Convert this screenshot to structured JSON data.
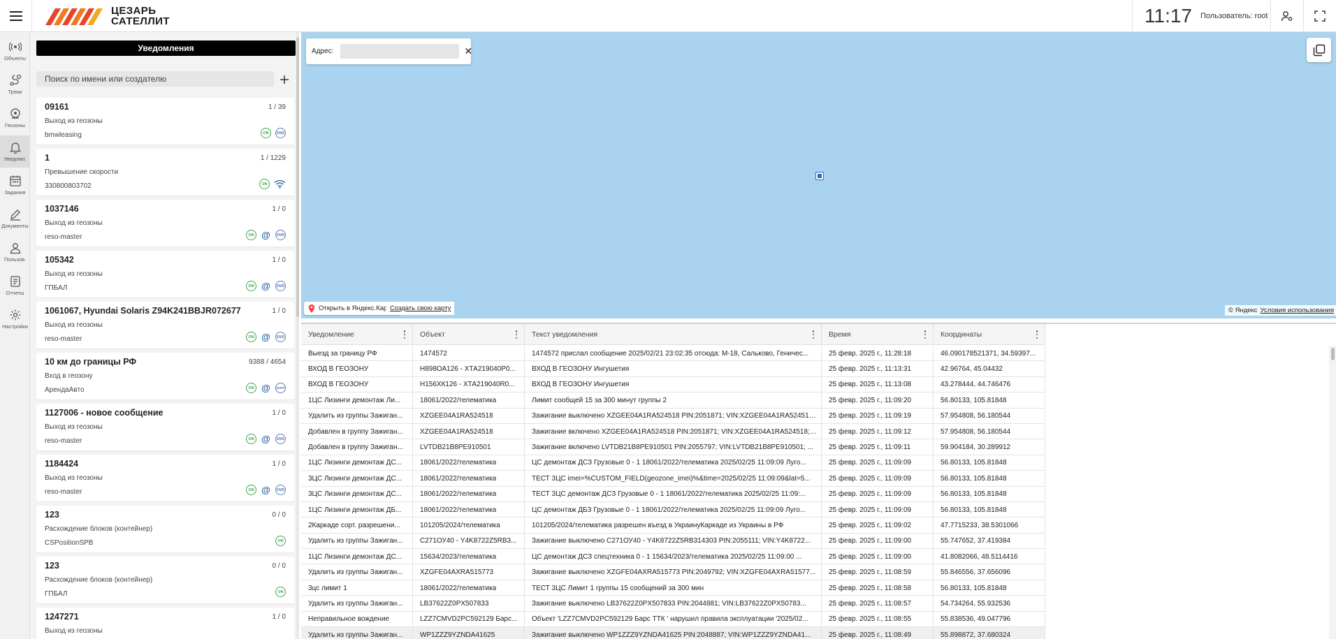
{
  "header": {
    "logo_line1": "ЦЕЗАРЬ",
    "logo_line2": "САТЕЛЛИТ",
    "time": "11:17",
    "user_label": "Пользователь: root"
  },
  "nav": [
    {
      "label": "Объекты",
      "icon": "antenna-icon"
    },
    {
      "label": "Треки",
      "icon": "route-icon"
    },
    {
      "label": "Геозоны",
      "icon": "geozone-icon"
    },
    {
      "label": "Уведомл.",
      "icon": "bell-icon"
    },
    {
      "label": "Задания",
      "icon": "calendar-icon"
    },
    {
      "label": "Документы",
      "icon": "pen-icon"
    },
    {
      "label": "Пользов.",
      "icon": "user-icon"
    },
    {
      "label": "Отчеты",
      "icon": "report-icon"
    },
    {
      "label": "Настройки",
      "icon": "gear-icon"
    }
  ],
  "panel": {
    "title": "Уведомления",
    "search_placeholder": "Поиск по имени или создателю",
    "cards": [
      {
        "title": "09161",
        "count": "1 / 39",
        "type": "Выход из геозоны",
        "creator": "bmwleasing",
        "icons": [
          "on",
          "sms"
        ]
      },
      {
        "title": "1",
        "count": "1 / 1229",
        "type": "Превышение скорости",
        "creator": "330800803702",
        "icons": [
          "on",
          "wifi"
        ]
      },
      {
        "title": "1037146",
        "count": "1 / 0",
        "type": "Выход из геозоны",
        "creator": "reso-master",
        "icons": [
          "on",
          "at",
          "sms"
        ]
      },
      {
        "title": "105342",
        "count": "1 / 0",
        "type": "Выход из геозоны",
        "creator": "ГПБАЛ",
        "icons": [
          "on",
          "at",
          "sms"
        ]
      },
      {
        "title": "1061067, Hyundai Solaris Z94K241BBJR072677",
        "count": "1 / 0",
        "type": "Выход из геозоны",
        "creator": "reso-master",
        "icons": [
          "on",
          "at",
          "sms"
        ]
      },
      {
        "title": "10 км до границы РФ",
        "count": "9388 / 4654",
        "type": "Вход в геозону",
        "creator": "АрендаАвто",
        "icons": [
          "on",
          "at",
          "smpp"
        ]
      },
      {
        "title": "1127006 - новое сообщение",
        "count": "1 / 0",
        "type": "Выход из геозоны",
        "creator": "reso-master",
        "icons": [
          "on",
          "at",
          "sms"
        ]
      },
      {
        "title": "1184424",
        "count": "1 / 0",
        "type": "Выход из геозоны",
        "creator": "reso-master",
        "icons": [
          "on",
          "at",
          "sms"
        ]
      },
      {
        "title": "123",
        "count": "0 / 0",
        "type": "Расхождение блоков (контейнер)",
        "creator": "CSPositionSPB",
        "icons": [
          "on"
        ]
      },
      {
        "title": "123",
        "count": "0 / 0",
        "type": "Расхождение блоков (контейнер)",
        "creator": "ГПБАЛ",
        "icons": [
          "on"
        ]
      },
      {
        "title": "1247271",
        "count": "1 / 0",
        "type": "Выход из геозоны",
        "creator": "",
        "icons": []
      }
    ]
  },
  "map": {
    "address_label": "Адрес:",
    "open_yandex": "Открыть в Яндекс.Картах",
    "create_map": "Создать свою карту",
    "copyright": "© Яндекс",
    "terms": "Условия использования"
  },
  "table": {
    "columns": [
      "Уведомление",
      "Объект",
      "Текст уведомления",
      "Время",
      "Координаты"
    ],
    "rows": [
      [
        "Выезд за границу РФ",
        "1474572",
        "1474572 прислал сообщение 2025/02/21 23:02:35 отсюда: М-18, Сальково, Геничес...",
        "25 февр. 2025 г., 11:28:18",
        "46.090178521371, 34.59397..."
      ],
      [
        "ВХОД В ГЕОЗОНУ",
        "Н898ОА126 - ХТА219040Р0...",
        "ВХОД В ГЕОЗОНУ Ингушетия",
        "25 февр. 2025 г., 11:13:31",
        "42.96764, 45.04432"
      ],
      [
        "ВХОД В ГЕОЗОНУ",
        "Н156ХК126 - ХТА219040R0...",
        "ВХОД В ГЕОЗОНУ Ингушетия",
        "25 февр. 2025 г., 11:13:08",
        "43.278444, 44.746476"
      ],
      [
        "1ЦС Лизинги демонтаж Ли...",
        "18061/2022/телематика",
        "Лимит сообщей 15 за 300 минут группы 2",
        "25 февр. 2025 г., 11:09:20",
        "56.80133, 105.81848"
      ],
      [
        "Удалить из группы Зажиган...",
        "XZGEE04A1RA524518",
        "Зажигание выключено XZGEE04A1RA524518 PIN:2051871; VIN:XZGEE04A1RA524518...",
        "25 февр. 2025 г., 11:09:19",
        "57.954808, 56.180544"
      ],
      [
        "Добавлен в группу Зажиган...",
        "XZGEE04A1RA524518",
        "Зажигание включено XZGEE04A1RA524518 PIN:2051871; VIN:XZGEE04A1RA524518; ...",
        "25 февр. 2025 г., 11:09:12",
        "57.954808, 56.180544"
      ],
      [
        "Добавлен в группу Зажиган...",
        "LVTDB21B8PE910501",
        "Зажигание включено LVTDB21B8PE910501 PIN:2055797; VIN:LVTDB21B8PE910501; ...",
        "25 февр. 2025 г., 11:09:11",
        "59.904184, 30.289912"
      ],
      [
        "1ЦС Лизинги демонтаж ДС...",
        "18061/2022/телематика",
        "ЦС демонтаж ДСЗ Грузовые 0 - 1 18061/2022/телематика 2025/02/25 11:09:09 Луго...",
        "25 февр. 2025 г., 11:09:09",
        "56.80133, 105.81848"
      ],
      [
        "3ЦС Лизинги демонтаж ДС...",
        "18061/2022/телематика",
        "ТЕСТ 3ЦС imei=%CUSTOM_FIELD(geozone_imei)%&time=2025/02/25 11:09:09&lat=5...",
        "25 февр. 2025 г., 11:09:09",
        "56.80133, 105.81848"
      ],
      [
        "3ЦС Лизинги демонтаж ДС...",
        "18061/2022/телематика",
        "ТЕСТ 3ЦС демонтаж ДСЗ Грузовые 0 - 1 18061/2022/телематика 2025/02/25 11:09:...",
        "25 февр. 2025 г., 11:09:09",
        "56.80133, 105.81848"
      ],
      [
        "1ЦС Лизинги демонтаж ДБ...",
        "18061/2022/телематика",
        "ЦС демонтаж ДБЗ Грузовые 0 - 1 18061/2022/телематика 2025/02/25 11:09:09 Луго...",
        "25 февр. 2025 г., 11:09:09",
        "56.80133, 105.81848"
      ],
      [
        "2Каркаде сорт. разрешени...",
        "101205/2024/телематика",
        "101205/2024/телематика разрешен въезд в УкраинуКаркаде из Украины в РФ",
        "25 февр. 2025 г., 11:09:02",
        "47.7715233, 38.5301066"
      ],
      [
        "Удалить из группы Зажиган...",
        "С271ОУ40 - Y4K8722Z5RB3...",
        "Зажигание выключено С271ОУ40 - Y4K8722Z5RB314303 PIN:2055111; VIN:Y4K8722...",
        "25 февр. 2025 г., 11:09:00",
        "55.747652, 37.419384"
      ],
      [
        "1ЦС Лизинги демонтаж ДС...",
        "15634/2023/телематика",
        "ЦС демонтаж ДСЗ спецтехника 0 - 1 15634/2023/телематика 2025/02/25 11:09:00 ...",
        "25 февр. 2025 г., 11:09:00",
        "41.8082066, 48.5114416"
      ],
      [
        "Удалить из группы Зажиган...",
        "XZGFE04AXRA515773",
        "Зажигание выключено XZGFE04AXRA515773 PIN:2049792; VIN:XZGFE04AXRA51577...",
        "25 февр. 2025 г., 11:08:59",
        "55.846556, 37.656096"
      ],
      [
        "3цс лимит 1",
        "18061/2022/телематика",
        "ТЕСТ 3ЦС Лимит 1 группы 15 сообщений за 300 мин",
        "25 февр. 2025 г., 11:08:58",
        "56.80133, 105.81848"
      ],
      [
        "Удалить из группы Зажиган...",
        "LB37622Z0PX507833",
        "Зажигание выключено LB37622Z0PX507833 PIN:2044881; VIN:LB37622Z0PX50783...",
        "25 февр. 2025 г., 11:08:57",
        "54.734264, 55.932536"
      ],
      [
        "Неправильное вождение",
        "LZZ7CMVD2PC592129 Барс...",
        "Объект 'LZZ7CMVD2PC592129 Барс ТТК ' нарушил правила эксплуатации '2025/02...",
        "25 февр. 2025 г., 11:08:55",
        "55.838536, 49.047796"
      ],
      [
        "Удалить из группы Зажиган...",
        "WP1ZZZ9YZNDA41625",
        "Зажигание выключено WP1ZZZ9YZNDA41625 PIN:2048887; VIN:WP1ZZZ9YZNDA41...",
        "25 февр. 2025 г., 11:08:49",
        "55.898872, 37.680324"
      ]
    ]
  },
  "colors": {
    "map_water": "#a9d3ee",
    "accent_green": "#3ea54a",
    "accent_blue": "#2b63a8",
    "logo_orange": "#e8442a"
  }
}
